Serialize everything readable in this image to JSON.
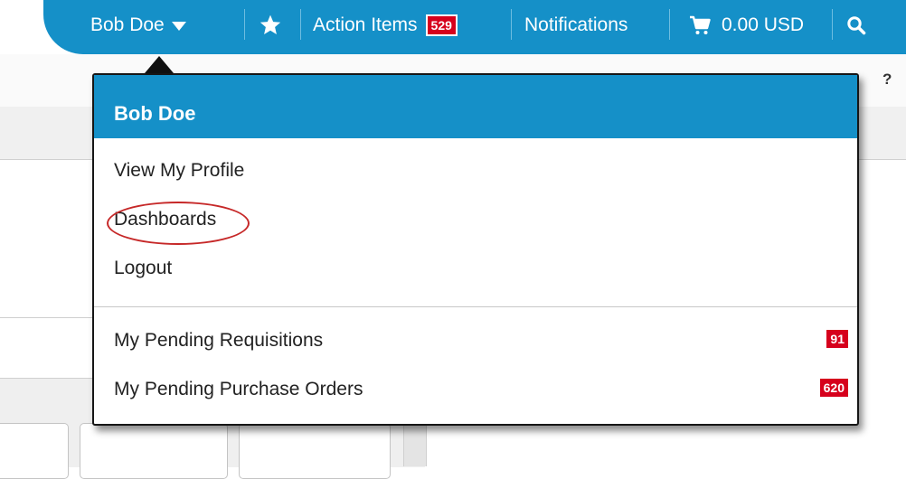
{
  "topnav": {
    "user_label": "Bob Doe",
    "action_items_label": "Action Items",
    "action_items_count": "529",
    "notifications_label": "Notifications",
    "cart_total": "0.00 USD",
    "icons": [
      "chevron-down-icon",
      "star-icon",
      "cart-icon",
      "search-icon"
    ]
  },
  "help": {
    "label": "?"
  },
  "dropdown": {
    "header": "Bob Doe",
    "items": [
      {
        "label": "View My Profile"
      },
      {
        "label": "Dashboards"
      },
      {
        "label": "Logout"
      }
    ],
    "pending": [
      {
        "label": "My Pending Requisitions",
        "count": "91"
      },
      {
        "label": "My Pending Purchase Orders",
        "count": "620"
      }
    ]
  },
  "colors": {
    "nav_blue": "#1590c8",
    "badge_red": "#d6001c",
    "highlight_ring": "#c62828"
  }
}
